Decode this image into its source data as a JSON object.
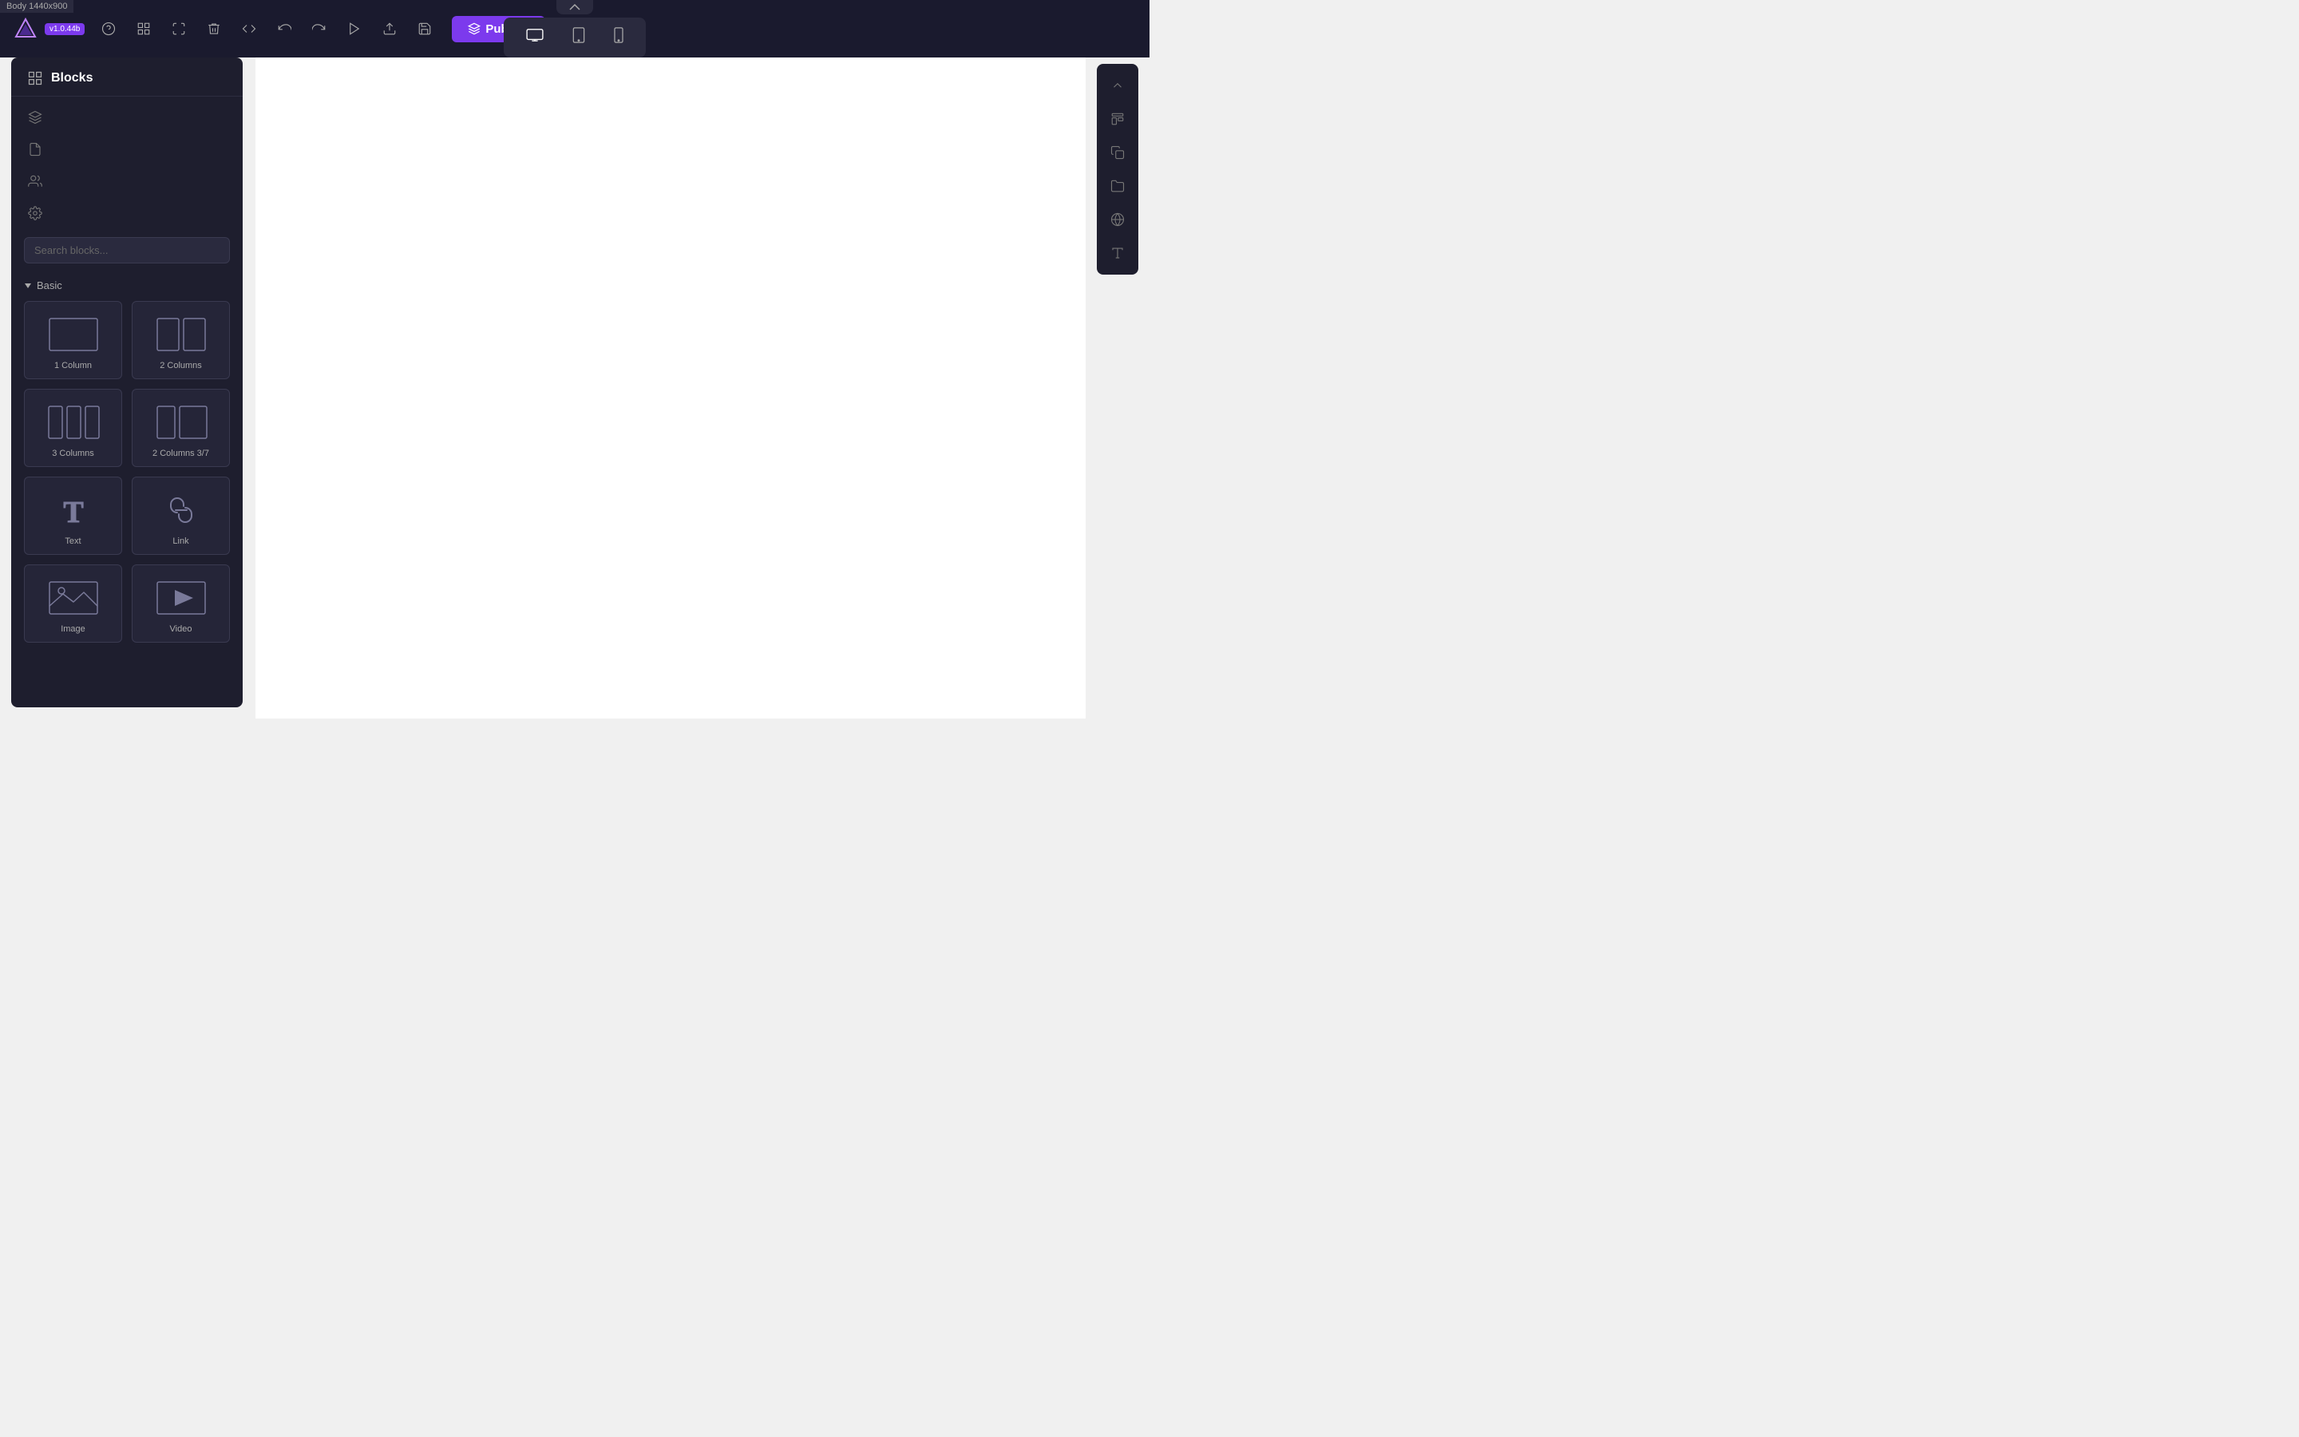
{
  "breadcrumb": "Body 1440x900",
  "version": "v1.0.44b",
  "toolbar": {
    "publish_label": "Publish"
  },
  "device_toolbar": {
    "up_arrow": "▲",
    "desktop_label": "Desktop",
    "tablet_label": "Tablet",
    "mobile_label": "Mobile"
  },
  "sidebar": {
    "title": "Blocks",
    "search_placeholder": "Search blocks...",
    "basic_section": "Basic",
    "blocks": [
      {
        "id": "1col",
        "label": "1 Column",
        "type": "one-col"
      },
      {
        "id": "2col",
        "label": "2 Columns",
        "type": "two-col"
      },
      {
        "id": "3col",
        "label": "3 Columns",
        "type": "three-col"
      },
      {
        "id": "2col37",
        "label": "2 Columns 3/7",
        "type": "two-col-37"
      },
      {
        "id": "text",
        "label": "Text",
        "type": "text"
      },
      {
        "id": "link",
        "label": "Link",
        "type": "link"
      },
      {
        "id": "image",
        "label": "Image",
        "type": "image"
      },
      {
        "id": "video",
        "label": "Video",
        "type": "video"
      }
    ]
  },
  "right_panel": {
    "buttons": [
      "chevron-up",
      "template",
      "copy",
      "folder",
      "globe",
      "text-t"
    ]
  }
}
